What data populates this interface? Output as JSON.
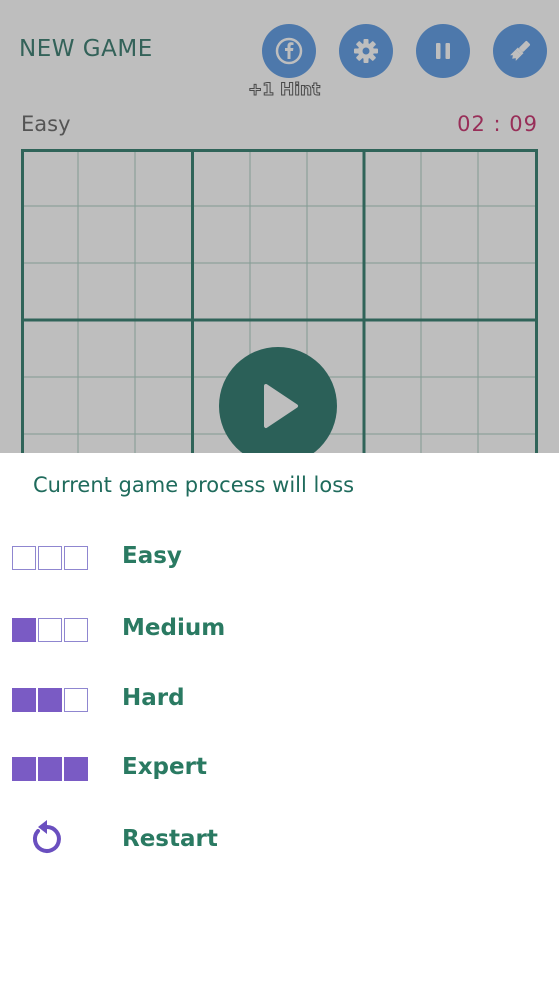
{
  "header": {
    "new_game_label": "NEW GAME",
    "hint_label": "+1 Hint",
    "icons": [
      "facebook-icon",
      "gear-icon",
      "pause-icon",
      "brush-icon"
    ]
  },
  "game": {
    "level": "Easy",
    "timer": "02 : 09"
  },
  "sheet": {
    "title": "Current game process will loss",
    "options": [
      {
        "label": "Easy",
        "filled": 0
      },
      {
        "label": "Medium",
        "filled": 1
      },
      {
        "label": "Hard",
        "filled": 2
      },
      {
        "label": "Expert",
        "filled": 3
      },
      {
        "label": "Restart",
        "icon": "restart-icon"
      }
    ]
  },
  "colors": {
    "accent": "#1f6b5c",
    "difficulty_fill": "#7a5bc4",
    "timer": "#c2185b",
    "play_button": "#12685b",
    "header_buttons": "#4a8fe0"
  }
}
